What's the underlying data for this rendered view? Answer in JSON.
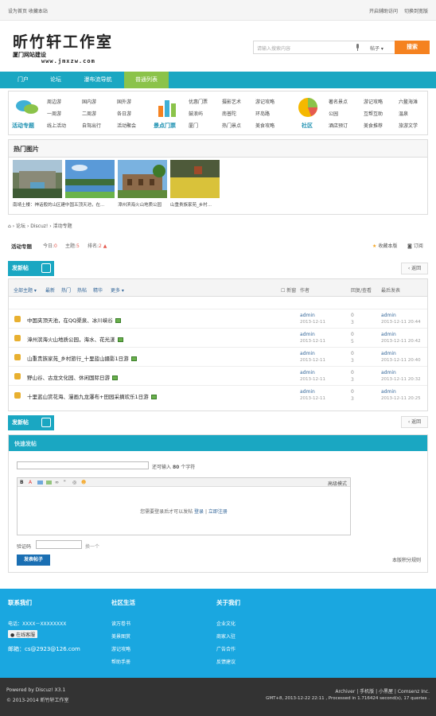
{
  "topbar": {
    "left": "设为首页  收藏本站",
    "right": [
      "开启辅助访问",
      "切换到宽版"
    ]
  },
  "header": {
    "site_name": "昕竹轩工作室",
    "tagline": "厦门网站建设",
    "domain": "www.jmxzw.com"
  },
  "search": {
    "placeholder": "请输入搜索内容",
    "scope": "帖子",
    "button": "搜索"
  },
  "nav": [
    "门户",
    "论坛",
    "瀑布流导航",
    "普通列表"
  ],
  "categories": {
    "huodong": {
      "title": "活动专题",
      "links": [
        "周边游",
        "国内游",
        "国外游",
        "一周游",
        "二周游",
        "各日游",
        "线上活动",
        "自驾出行",
        "活动聚会"
      ]
    },
    "jingdian": {
      "title": "景点门票",
      "links": [
        "优惠门票",
        "摄影艺术",
        "游记攻略",
        "鼓浪屿",
        "南普陀",
        "环岛路",
        "厦门",
        "热门景点",
        "美食攻略"
      ]
    },
    "shequ": {
      "title": "社区",
      "links": [
        "著名景点",
        "游记攻略",
        "六鳌海滩",
        "公园",
        "互帮互助",
        "温泉",
        "酒店预订",
        "美食推荐",
        "旅游文学"
      ]
    }
  },
  "hot_pics": {
    "title": "热门图片",
    "items": [
      {
        "caption": "南靖土楼：神话般的山区建筑模式"
      },
      {
        "caption": "中国五顶天池，在..."
      },
      {
        "caption": "漳州滨海火山地质公园"
      },
      {
        "caption": "山重贵族家苑_乡村..."
      }
    ]
  },
  "breadcrumb": [
    "论坛",
    "Discuz!",
    "活动专题"
  ],
  "forum": {
    "name": "活动专题",
    "stats": [
      {
        "label": "今日:",
        "value": "0"
      },
      {
        "label": "主题:",
        "value": "5"
      },
      {
        "label": "排名:",
        "value": "2"
      }
    ],
    "actions": [
      "收藏本版",
      "订阅"
    ]
  },
  "post_button": "发新帖",
  "back_button": "返回",
  "thread_tabs": [
    "全部主题",
    "最新",
    "热门",
    "热帖",
    "精华",
    "更多"
  ],
  "thread_columns": {
    "new": "新窗",
    "author": "作者",
    "replies": "回复/查看",
    "last": "最后发表"
  },
  "threads": [
    {
      "title": "中国夹顶天池，在QQ渠泉、冰川峡谷",
      "author": "admin",
      "date": "2013-12-11",
      "replies": "0",
      "views": "3",
      "last_author": "admin",
      "last_date": "2013-12-11 20:44"
    },
    {
      "title": "漳州滨海火山地质公园，海水、花光漾",
      "author": "admin",
      "date": "2013-12-11",
      "replies": "0",
      "views": "5",
      "last_author": "admin",
      "last_date": "2013-12-11 20:42"
    },
    {
      "title": "山重贵族家苑_乡村旅行_十里蓝山摄影1日游",
      "author": "admin",
      "date": "2013-12-11",
      "replies": "0",
      "views": "3",
      "last_author": "admin",
      "last_date": "2013-12-11 20:40"
    },
    {
      "title": "野山谷、古龙文化园、休闲国际日游",
      "author": "admin",
      "date": "2013-12-11",
      "replies": "0",
      "views": "3",
      "last_author": "admin",
      "last_date": "2013-12-11 20:32"
    },
    {
      "title": "十里蓝山赏花海、漫画九龙瀑布+田园采摘欢乐1日游",
      "author": "admin",
      "date": "2013-12-11",
      "replies": "0",
      "views": "3",
      "last_author": "admin",
      "last_date": "2013-12-11 20:25"
    }
  ],
  "quick_post": {
    "title": "快速发帖",
    "limit_pre": "还可输入",
    "limit_num": "80",
    "limit_post": "个字符",
    "advanced": "高级模式",
    "login_msg_a": "您需要登录后才可以发帖",
    "login": "登录",
    "sep": "|",
    "register": "立即注册",
    "captcha_label": "验证码",
    "captcha_refresh": "换一个",
    "submit": "发表帖子",
    "rules": "本版积分规则"
  },
  "footer": {
    "cols": [
      {
        "title": "联系我们",
        "items": [
          "电话：XXXX－XXXXXXXX",
          "邮箱：cs@2923@126.com"
        ]
      },
      {
        "title": "社区生活",
        "items": [
          "读万卷书",
          "美景图赏",
          "游记攻略",
          "帮助手册"
        ]
      },
      {
        "title": "关于我们",
        "items": [
          "企业文化",
          "商家入驻",
          "广告合作",
          "反馈建议"
        ]
      }
    ],
    "qq_button": "在线客服"
  },
  "bottom": {
    "powered": "Powered by Discuz! X3.1",
    "copyright": "© 2013-2014 昕竹轩工作室",
    "links": "Archiver | 手机版 | 小黑屋 | Comsenz Inc.",
    "gmt": "GMT+8, 2013-12-22 22:11 , Processed in 1.716424 second(s), 17 queries ."
  }
}
